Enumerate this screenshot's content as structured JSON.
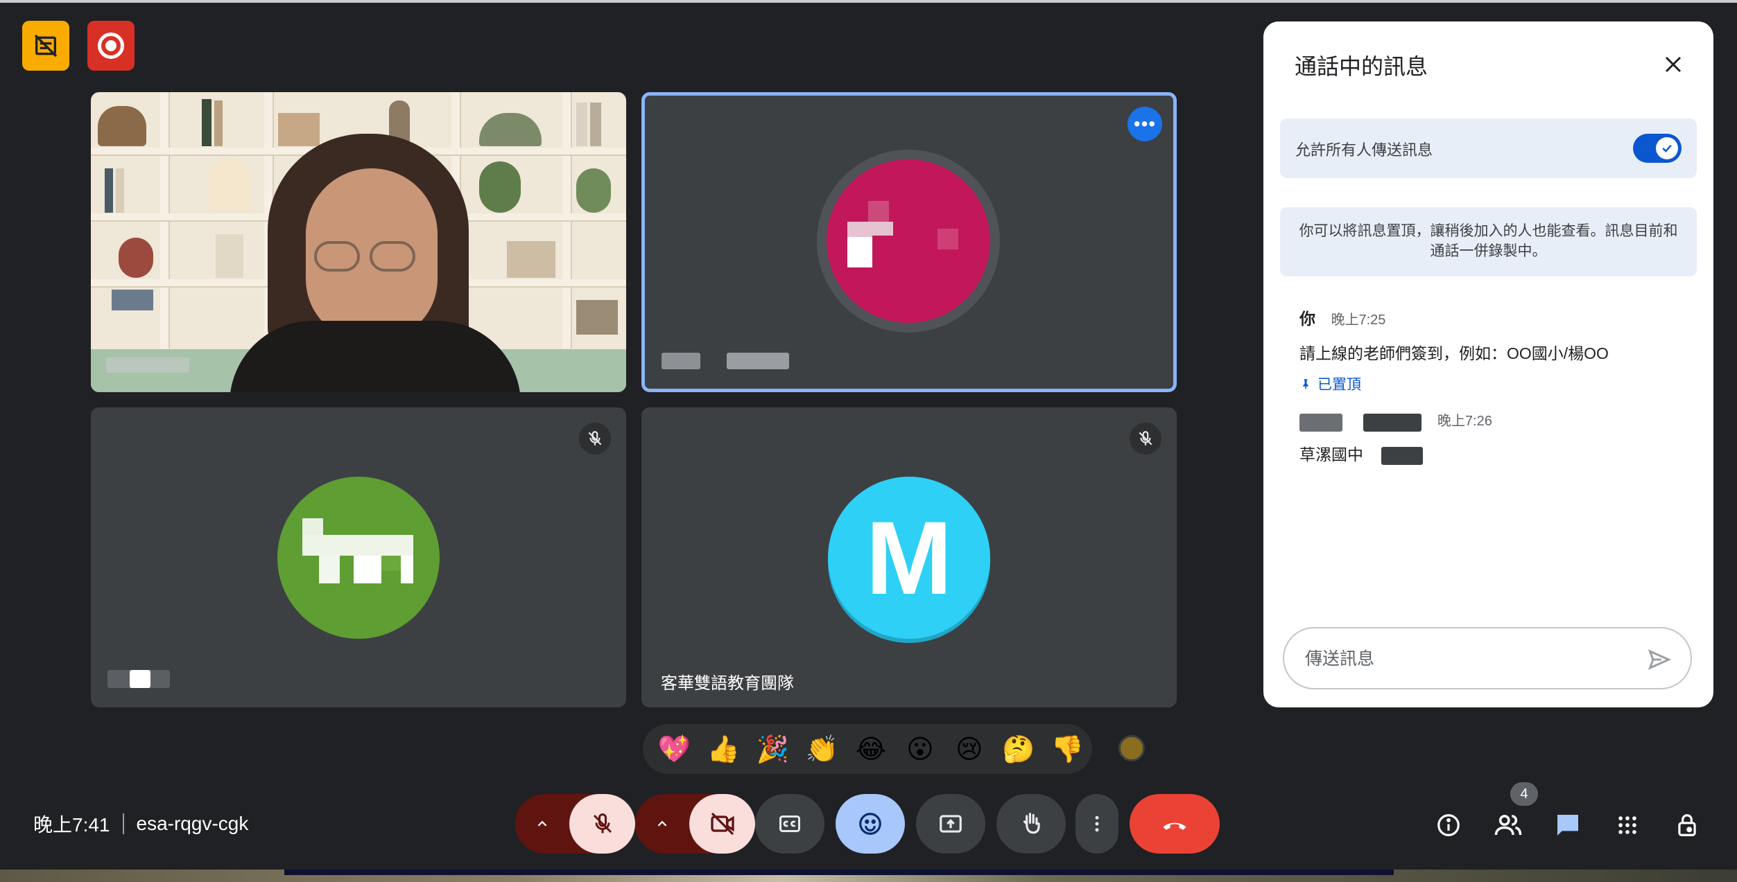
{
  "indicators": {
    "ai_notes_icon": "notes-off-icon",
    "recording_icon": "record-icon"
  },
  "tiles": [
    {
      "id": "participant-video",
      "name_label": "",
      "muted": false
    },
    {
      "id": "participant-pink",
      "name_label": "",
      "muted": false,
      "pinned_highlight": true
    },
    {
      "id": "participant-green",
      "name_label": "",
      "muted": true
    },
    {
      "id": "participant-m",
      "name_label": "客華雙語教育團隊",
      "avatar_letter": "M",
      "muted": true
    }
  ],
  "reactions": [
    "💖",
    "👍",
    "🎉",
    "👏",
    "😂",
    "😮",
    "😢",
    "🤔",
    "👎"
  ],
  "meeting": {
    "time": "晚上7:41",
    "code": "esa-rqgv-cgk"
  },
  "participants_count": "4",
  "chat_panel": {
    "title": "通話中的訊息",
    "allow_all_label": "允許所有人傳送訊息",
    "allow_all_enabled": true,
    "info_text": "你可以將訊息置頂，讓稍後加入的人也能查看。訊息目前和通話一併錄製中。",
    "messages": [
      {
        "sender": "你",
        "time": "晚上7:25",
        "text": "請上線的老師們簽到，例如：OO國小/楊OO",
        "pinned_label": "已置頂"
      },
      {
        "sender": "",
        "time": "晚上7:26",
        "text": "草漯國中"
      }
    ],
    "composer_placeholder": "傳送訊息"
  },
  "colors": {
    "accent_blue": "#0b57d0",
    "end_call_red": "#ea4335",
    "tile_bg": "#3c4043",
    "highlight_border": "#8ab4f8"
  }
}
